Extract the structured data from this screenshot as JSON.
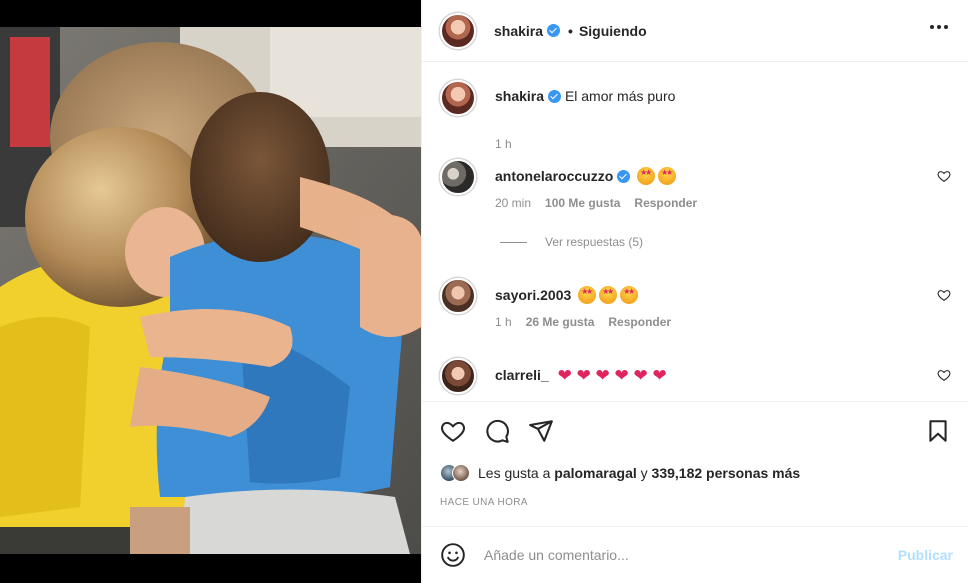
{
  "post": {
    "author": "shakira",
    "follow_state": "Siguiendo",
    "caption_author": "shakira",
    "caption": "El amor más puro",
    "caption_time": "1 h"
  },
  "comments": [
    {
      "user": "antonelaroccuzzo",
      "verified": true,
      "emojis": [
        "star-struck",
        "star-struck"
      ],
      "time": "20 min",
      "likes": "100 Me gusta",
      "reply": "Responder",
      "view_replies": "Ver respuestas (5)"
    },
    {
      "user": "sayori.2003",
      "verified": false,
      "emojis": [
        "star-struck",
        "star-struck",
        "star-struck"
      ],
      "time": "1 h",
      "likes": "26 Me gusta",
      "reply": "Responder"
    },
    {
      "user": "clarreli_",
      "verified": false,
      "emojis": [
        "red-heart",
        "red-heart",
        "red-heart",
        "red-heart",
        "red-heart",
        "red-heart"
      ],
      "heart_text": "❤ ❤ ❤ ❤ ❤ ❤"
    }
  ],
  "likes": {
    "prefix": "Les gusta a",
    "liker": "palomaragal",
    "connector": "y",
    "others": "339,182 personas más"
  },
  "timestamp": "HACE UNA HORA",
  "comment_input": {
    "placeholder": "Añade un comentario...",
    "submit": "Publicar"
  },
  "colors": {
    "verified": "#3897f0",
    "heart": "#e0245e",
    "publish_disabled": "#b2dffc",
    "muted": "#8e8e8e"
  }
}
